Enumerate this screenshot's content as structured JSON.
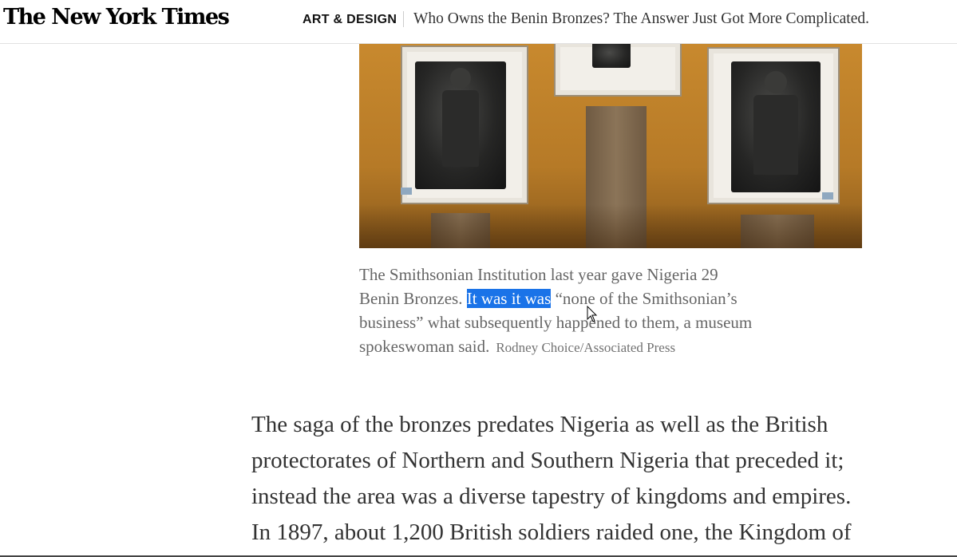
{
  "header": {
    "logo_text": "The New York Times",
    "section": "ART & DESIGN",
    "headline": "Who Owns the Benin Bronzes? The Answer Just Got More Complicated."
  },
  "photo": {
    "description_icon": "photo-benin-bronzes"
  },
  "caption": {
    "part1": "The Smithsonian Institution last year gave Nigeria 29",
    "part2_before": "Benin Bronzes. ",
    "highlighted": "It was it was",
    "part2_after": " “none of the Smithsonian’s",
    "part3": "business” what subsequently happened to them, a museum",
    "part4": "spokeswoman said.",
    "credit": "Rodney Choice/Associated Press"
  },
  "article": {
    "lines": [
      "The saga of the bronzes predates Nigeria as well as the British",
      "protectorates of Northern and Southern Nigeria that preceded it;",
      "instead the area was a diverse tapestry of kingdoms and empires.",
      "In 1897, about 1,200 British soldiers raided one, the Kingdom of"
    ]
  },
  "colors": {
    "selection": "#1a73e8",
    "caption_text": "#666666",
    "body_text": "#333333"
  }
}
